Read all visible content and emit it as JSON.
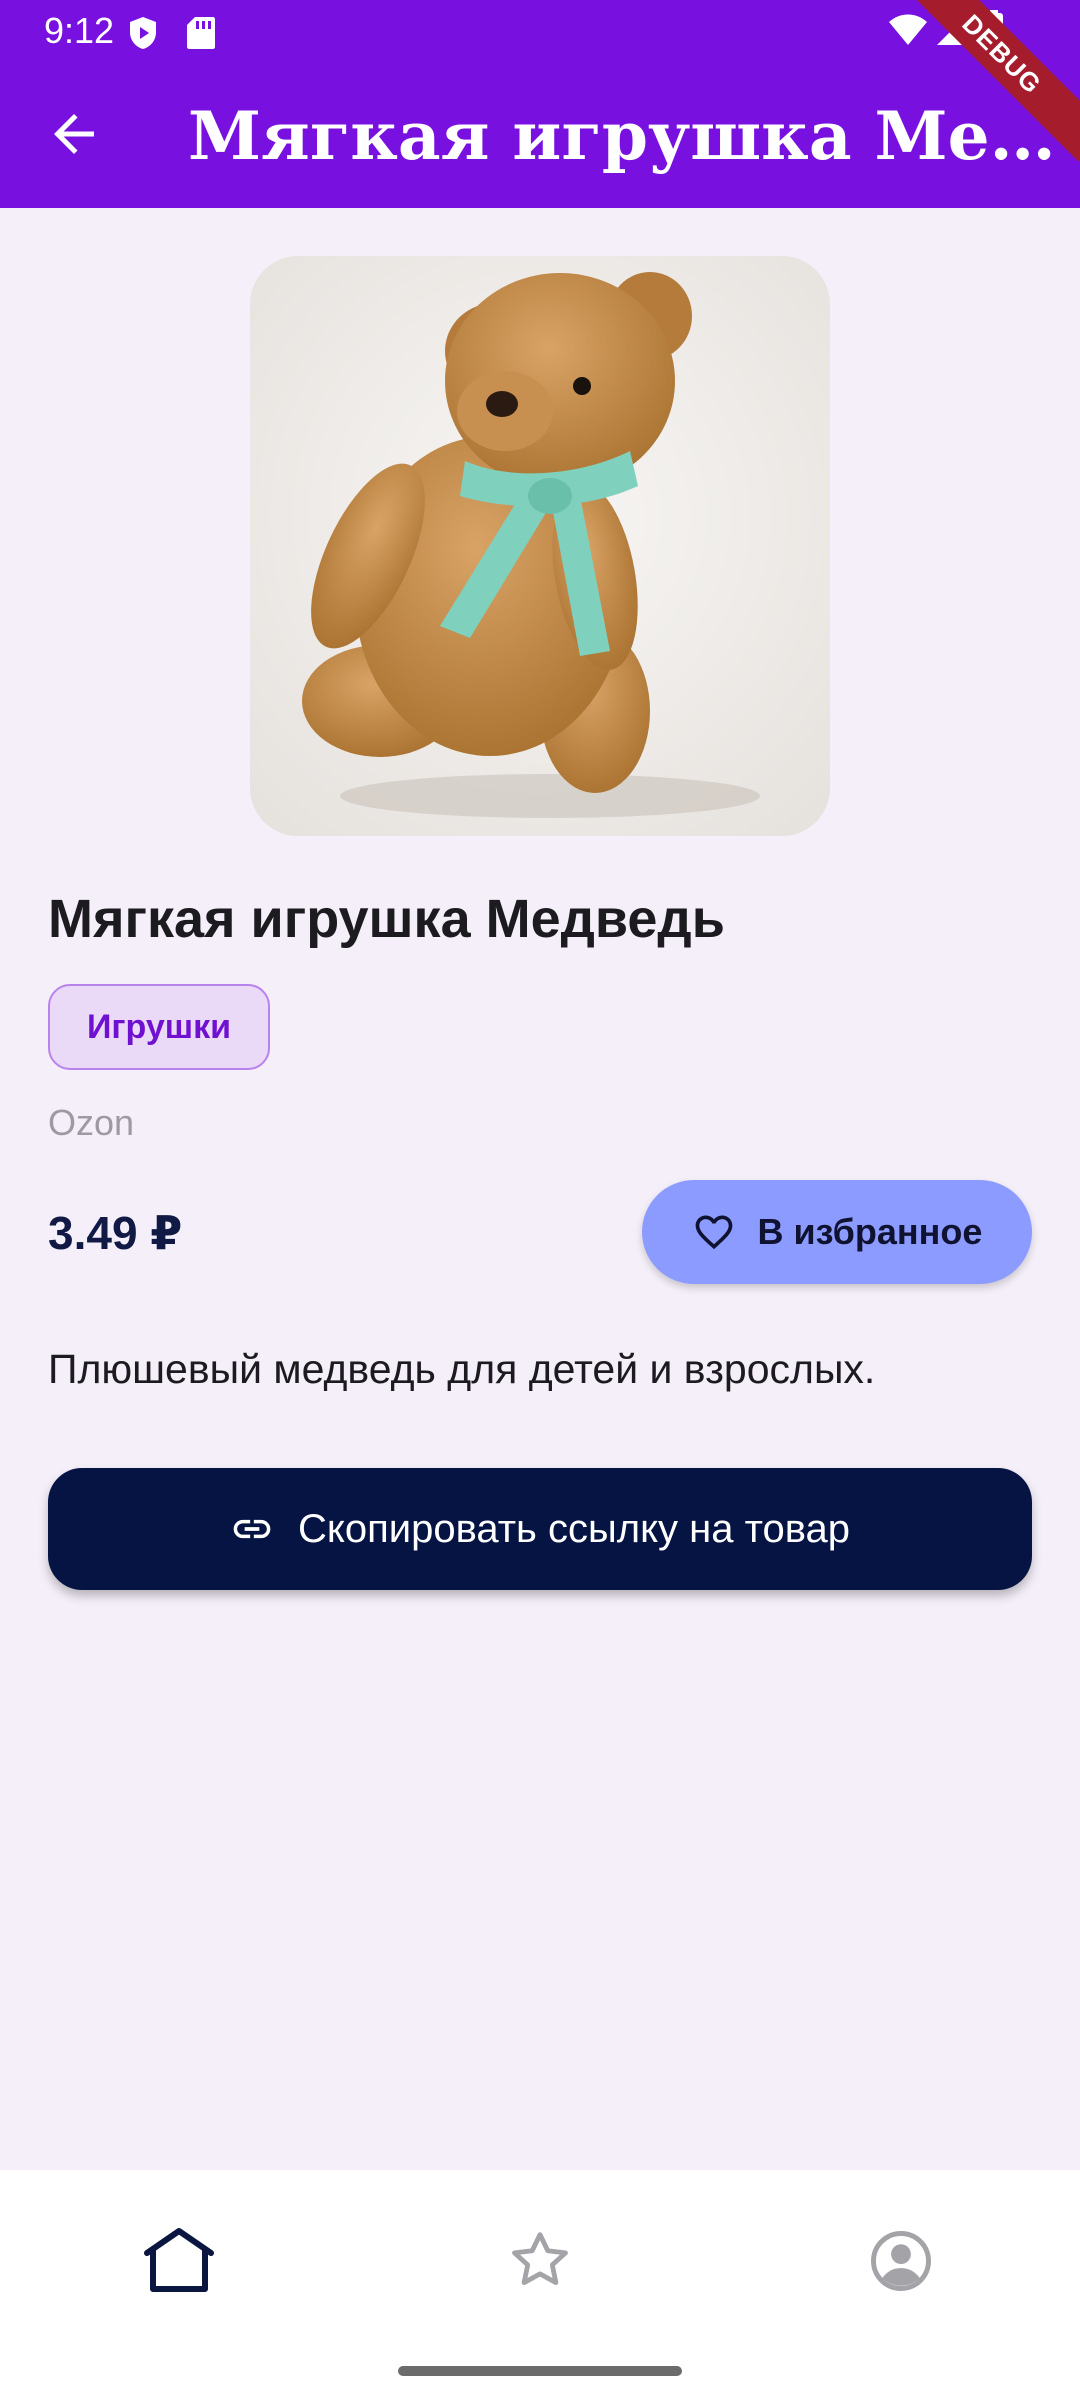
{
  "status_bar": {
    "time": "9:12",
    "icons": [
      "shield-play-icon",
      "sd-card-icon",
      "wifi-icon",
      "signal-icon",
      "battery-icon"
    ]
  },
  "app_bar": {
    "title": "Мягкая игрушка Медведь",
    "back_icon": "arrow-back-icon",
    "debug_banner": "DEBUG",
    "color": "#7810e0"
  },
  "product": {
    "image_description": "teddy bear photo",
    "name": "Мягкая игрушка Медведь",
    "category": "Игрушки",
    "store": "Ozon",
    "price": "3.49 ₽",
    "favorite_label": "В избранное",
    "description": "Плюшевый медведь для детей и взрослых.",
    "copy_link_label": "Скопировать ссылку на товар"
  },
  "bottom_nav": {
    "items": [
      {
        "icon": "home-icon",
        "active": true
      },
      {
        "icon": "star-icon",
        "active": false
      },
      {
        "icon": "account-icon",
        "active": false
      }
    ]
  },
  "colors": {
    "background": "#f5eff9",
    "accent": "#7810e0",
    "favorite_button": "#8c9bff",
    "primary_button": "#061443"
  }
}
